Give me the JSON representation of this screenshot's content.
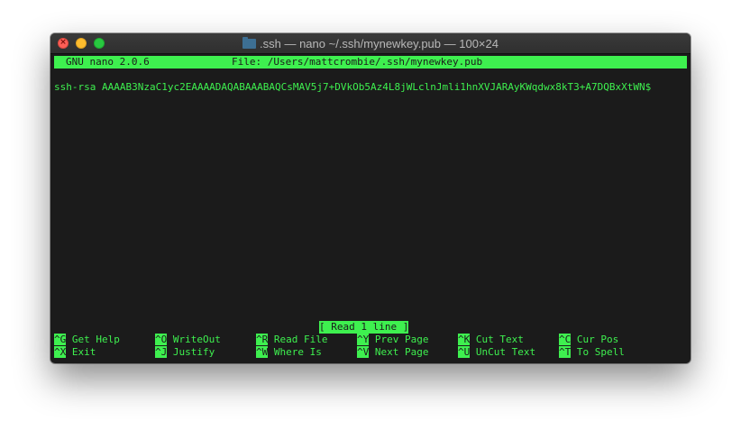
{
  "window": {
    "title": ".ssh — nano ~/.ssh/mynewkey.pub — 100×24"
  },
  "nano": {
    "version": "GNU nano 2.0.6",
    "file": "File: /Users/mattcrombie/.ssh/mynewkey.pub",
    "content": "ssh-rsa AAAAB3NzaC1yc2EAAAADAQABAAABAQCsMAV5j7+DVkOb5Az4L8jWLclnJmli1hnXVJARAyKWqdwx8kT3+A7DQBxXtWN$",
    "status": "[ Read 1 line ]",
    "shortcuts_row1": [
      {
        "key": "^G",
        "label": "Get Help"
      },
      {
        "key": "^O",
        "label": "WriteOut"
      },
      {
        "key": "^R",
        "label": "Read File"
      },
      {
        "key": "^Y",
        "label": "Prev Page"
      },
      {
        "key": "^K",
        "label": "Cut Text"
      },
      {
        "key": "^C",
        "label": "Cur Pos"
      }
    ],
    "shortcuts_row2": [
      {
        "key": "^X",
        "label": "Exit"
      },
      {
        "key": "^J",
        "label": "Justify"
      },
      {
        "key": "^W",
        "label": "Where Is"
      },
      {
        "key": "^V",
        "label": "Next Page"
      },
      {
        "key": "^U",
        "label": "UnCut Text"
      },
      {
        "key": "^T",
        "label": "To Spell"
      }
    ]
  },
  "colors": {
    "terminal_bg": "#1b1b1b",
    "terminal_fg": "#3ef04f"
  }
}
